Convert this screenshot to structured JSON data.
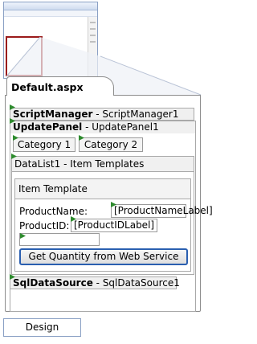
{
  "document": {
    "tab_title": "Default.aspx"
  },
  "controls": {
    "script_manager": {
      "type": "ScriptManager",
      "id": "ScriptManager1",
      "separator": " - "
    },
    "update_panel": {
      "type": "UpdatePanel",
      "id": "UpdatePanel1",
      "separator": " - "
    },
    "category_buttons": [
      "Category 1",
      "Category 2"
    ],
    "data_list_header": "DataList1 - Item Templates",
    "item_template_header": "Item Template",
    "product_name_label": "ProductName:",
    "product_name_value": "[ProductNameLabel]",
    "product_id_label": "ProductID:",
    "product_id_value": "[ProductIDLabel]",
    "get_quantity_button": "Get Quantity from Web Service",
    "sql_data_source": {
      "type": "SqlDataSource",
      "id": "SqlDataSource1",
      "separator": " - "
    }
  },
  "view_tabs": {
    "design": "Design"
  },
  "icons": {
    "smart_tag": "smart-tag-triangle-icon"
  },
  "colors": {
    "selection_border": "#9b1b1b",
    "button_focus": "#2a5fb0",
    "smart_tag": "#2e8b2e",
    "control_header_bg": "#f0f0f0"
  }
}
